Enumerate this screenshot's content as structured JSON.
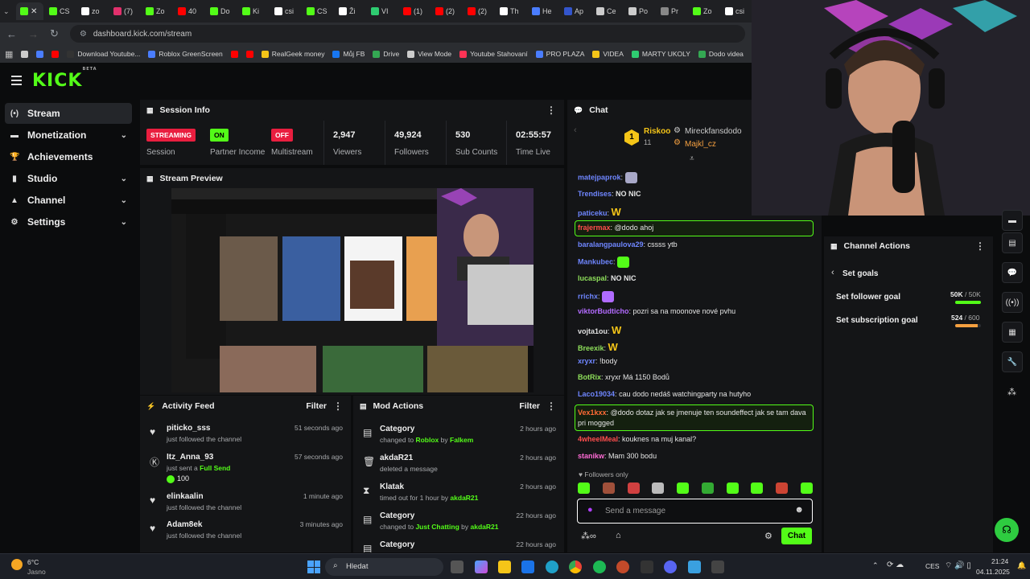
{
  "browser": {
    "tabs": [
      {
        "label": "",
        "color": "#53fc18",
        "active": true
      },
      {
        "label": "CS",
        "color": "#53fc18"
      },
      {
        "label": "zo",
        "color": "#ffffff"
      },
      {
        "label": "(7)",
        "color": "#e1306c"
      },
      {
        "label": "Zo",
        "color": "#53fc18"
      },
      {
        "label": "40",
        "color": "#ff0000"
      },
      {
        "label": "Do",
        "color": "#53fc18"
      },
      {
        "label": "Ki",
        "color": "#53fc18"
      },
      {
        "label": "csi",
        "color": "#ffffff"
      },
      {
        "label": "CS",
        "color": "#53fc18"
      },
      {
        "label": "Ži",
        "color": "#ffffff"
      },
      {
        "label": "VI",
        "color": "#2ecc71"
      },
      {
        "label": "(1)",
        "color": "#ff0000"
      },
      {
        "label": "(2)",
        "color": "#ff0000"
      },
      {
        "label": "(2)",
        "color": "#ff0000"
      },
      {
        "label": "Th",
        "color": "#ffffff"
      },
      {
        "label": "He",
        "color": "#4a7dff"
      },
      {
        "label": "Ap",
        "color": "#3355cc"
      },
      {
        "label": "Ce",
        "color": "#cccccc"
      },
      {
        "label": "Po",
        "color": "#cccccc"
      },
      {
        "label": "Pr",
        "color": "#888888"
      },
      {
        "label": "Zo",
        "color": "#53fc18"
      },
      {
        "label": "csi",
        "color": "#ffffff"
      }
    ],
    "url": "dashboard.kick.com/stream",
    "bookmarks": [
      {
        "label": "",
        "color": "#cccccc"
      },
      {
        "label": "",
        "color": "#4a7dff"
      },
      {
        "label": "",
        "color": "#ff0000"
      },
      {
        "label": "Download Youtube...",
        "color": "#333333"
      },
      {
        "label": "Roblox GreenScreen",
        "color": "#4a7dff"
      },
      {
        "label": "",
        "color": "#ff0000"
      },
      {
        "label": "",
        "color": "#ff0000"
      },
      {
        "label": "RealGeek money",
        "color": "#f5c518"
      },
      {
        "label": "Můj FB",
        "color": "#1877f2"
      },
      {
        "label": "Drive",
        "color": "#34a853"
      },
      {
        "label": "View Mode",
        "color": "#cccccc"
      },
      {
        "label": "Youtube Stahovaní",
        "color": "#ff3355"
      },
      {
        "label": "PRO PLAZA",
        "color": "#4a7dff"
      },
      {
        "label": "VIDEA",
        "color": "#f5c518"
      },
      {
        "label": "MARTY UKOLY",
        "color": "#2ecc71"
      },
      {
        "label": "Dodo videa",
        "color": "#34a853"
      }
    ]
  },
  "kick": {
    "logo": "KICK",
    "logo_sup": "BETA",
    "sidebar": [
      {
        "label": "Stream",
        "icon": "(•)",
        "active": true,
        "chevron": false
      },
      {
        "label": "Monetization",
        "icon": "▬",
        "chevron": true
      },
      {
        "label": "Achievements",
        "icon": "🏆",
        "chevron": false
      },
      {
        "label": "Studio",
        "icon": "▮",
        "chevron": true
      },
      {
        "label": "Channel",
        "icon": "▲",
        "chevron": true
      },
      {
        "label": "Settings",
        "icon": "⚙",
        "chevron": true
      }
    ]
  },
  "session": {
    "title": "Session Info",
    "session_badge": "STREAMING",
    "session_label": "Session",
    "partner_badge": "ON",
    "partner_label": "Partner Income",
    "multistream_badge": "OFF",
    "multistream_label": "Multistream",
    "viewers": "2,947",
    "viewers_label": "Viewers",
    "followers": "49,924",
    "followers_label": "Followers",
    "subs": "530",
    "subs_label": "Sub Counts",
    "time": "02:55:57",
    "time_label": "Time Live",
    "colors": {
      "streaming": "#e91e3f",
      "on": "#53fc18",
      "off": "#e91e3f"
    }
  },
  "preview": {
    "title": "Stream Preview"
  },
  "activity": {
    "title": "Activity Feed",
    "filter": "Filter",
    "items": [
      {
        "icon": "heart-icon",
        "glyph": "♥",
        "user": "piticko_sss",
        "action": "just followed the channel",
        "time": "51 seconds ago"
      },
      {
        "icon": "kick-icon",
        "glyph": "Ⓚ",
        "user": "Itz_Anna_93",
        "action": "just sent a",
        "highlight": "Full Send",
        "amount": "100",
        "time": "57 seconds ago"
      },
      {
        "icon": "heart-icon",
        "glyph": "♥",
        "user": "elinkaalin",
        "action": "just followed the channel",
        "time": "1 minute ago"
      },
      {
        "icon": "heart-icon",
        "glyph": "♥",
        "user": "Adam8ek",
        "action": "just followed the channel",
        "time": "3 minutes ago"
      }
    ]
  },
  "mod": {
    "title": "Mod Actions",
    "filter": "Filter",
    "items": [
      {
        "glyph": "▤",
        "title": "Category",
        "pre": "changed to",
        "target": "Roblox",
        "mid": "by",
        "by": "Falkem",
        "time": "2 hours ago"
      },
      {
        "glyph": "🗑",
        "title": "akdaR21",
        "pre": "deleted a message",
        "target": "",
        "mid": "",
        "by": "",
        "time": "2 hours ago"
      },
      {
        "glyph": "⧗",
        "title": "Klatak",
        "pre": "timed out for 1 hour by",
        "target": "",
        "mid": "",
        "by": "akdaR21",
        "time": "2 hours ago"
      },
      {
        "glyph": "▤",
        "title": "Category",
        "pre": "changed to",
        "target": "Just Chatting",
        "mid": "by",
        "by": "akdaR21",
        "time": "22 hours ago"
      },
      {
        "glyph": "▤",
        "title": "Category",
        "pre": "",
        "target": "",
        "mid": "",
        "by": "",
        "time": "22 hours ago"
      }
    ]
  },
  "chat": {
    "title": "Chat",
    "top_user": "Riskoo",
    "top_rank": "1",
    "top_count": "11",
    "gifter1": "Mireckfansdodo",
    "gifter2": "Majkl_cz",
    "messages": [
      {
        "user": "matejpaprok",
        "color": "#6f86ff",
        "text": ""
      },
      {
        "user": "Trendises",
        "color": "#6f86ff",
        "text": "NO NIC"
      },
      {
        "user": "paticeku",
        "color": "#6f86ff",
        "text": "W"
      },
      {
        "user": "frajermax",
        "color": "#ff4d4d",
        "text": "@dodo ahoj",
        "hl": true
      },
      {
        "user": "baralangpaulova29",
        "color": "#6f86ff",
        "text": "cssss ytb"
      },
      {
        "user": "Mankubec",
        "color": "#6f86ff",
        "text": ""
      },
      {
        "user": "lucaspal",
        "color": "#8fe05b",
        "text": "NO NIC"
      },
      {
        "user": "rrichx",
        "color": "#6f86ff",
        "text": ""
      },
      {
        "user": "viktorBudticho",
        "color": "#b36bff",
        "text": "pozri sa na moonove nové pvhu"
      },
      {
        "user": "vojta1ou",
        "color": "#e0e0e0",
        "text": "W"
      },
      {
        "user": "Breexik",
        "color": "#8fe05b",
        "text": "W"
      },
      {
        "user": "xryxr",
        "color": "#6f86ff",
        "text": "!body"
      },
      {
        "user": "BotRix",
        "color": "#8fe05b",
        "text": "xryxr Má 1150 Bodů"
      },
      {
        "user": "Laco19034",
        "color": "#6f86ff",
        "text": "cau dodo nedáš watchingparty na hutyho"
      },
      {
        "user": "Vex1kxx",
        "color": "#ff6b35",
        "text": "@dodo dotaz jak se jmenuje ten soundeffect jak se tam dava pri mogged",
        "hl": true
      },
      {
        "user": "4wheelMeal",
        "color": "#ff4d4d",
        "text": "kouknes na muj kanal?"
      },
      {
        "user": "stanikw",
        "color": "#ff6bd5",
        "text": "Mam 300 bodu"
      }
    ],
    "followers_only": "Followers only",
    "placeholder": "Send a message",
    "send": "Chat"
  },
  "channel_actions": {
    "title": "Channel Actions",
    "goals_title": "Set goals",
    "follower_goal": "Set follower goal",
    "follower_value": "50K",
    "follower_max": "50K",
    "follower_progress": 1.0,
    "sub_goal": "Set subscription goal",
    "sub_value": "524",
    "sub_max": "600",
    "sub_progress": 0.873
  },
  "taskbar": {
    "weather_temp": "6°C",
    "weather_desc": "Jasno",
    "search": "Hledat",
    "lang": "CES",
    "time": "21:24",
    "date": "04.11.2025"
  }
}
